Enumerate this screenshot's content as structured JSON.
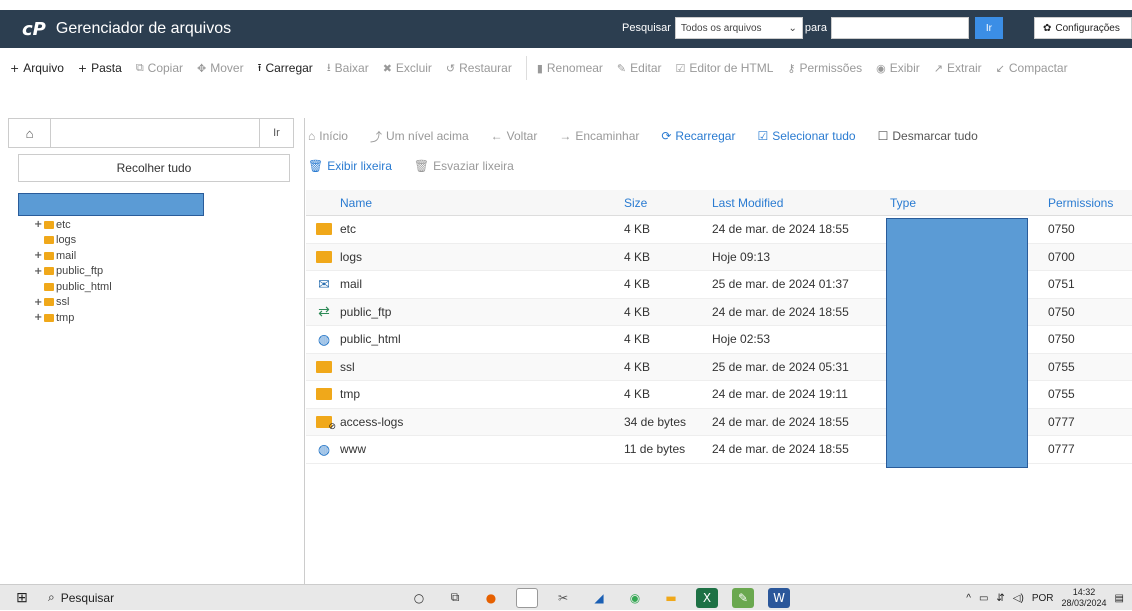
{
  "header": {
    "logo": "cP",
    "title": "Gerenciador de arquivos",
    "search_label": "Pesquisar",
    "search_scope": "Todos os arquivos",
    "for_label": "para",
    "go_label": "Ir",
    "settings_label": "Configurações"
  },
  "toolbar": [
    {
      "label": "Arquivo",
      "icon": "+",
      "active": true
    },
    {
      "label": "Pasta",
      "icon": "+",
      "active": true
    },
    {
      "label": "Copiar",
      "icon": "⧉",
      "active": false
    },
    {
      "label": "Mover",
      "icon": "✥",
      "active": false
    },
    {
      "label": "Carregar",
      "icon": "⭱",
      "active": true
    },
    {
      "label": "Baixar",
      "icon": "⭳",
      "active": false
    },
    {
      "label": "Excluir",
      "icon": "✖",
      "active": false
    },
    {
      "label": "Restaurar",
      "icon": "↺",
      "active": false
    },
    {
      "label": "Renomear",
      "icon": "▮",
      "active": false
    },
    {
      "label": "Editar",
      "icon": "✎",
      "active": false
    },
    {
      "label": "Editor de HTML",
      "icon": "☑",
      "active": false
    },
    {
      "label": "Permissões",
      "icon": "⚷",
      "active": false
    },
    {
      "label": "Exibir",
      "icon": "◉",
      "active": false
    },
    {
      "label": "Extrair",
      "icon": "↗",
      "active": false
    },
    {
      "label": "Compactar",
      "icon": "↙",
      "active": false
    }
  ],
  "left": {
    "go_label": "Ir",
    "collapse_label": "Recolher tudo",
    "tree": [
      {
        "label": "etc",
        "expandable": true
      },
      {
        "label": "logs",
        "expandable": false
      },
      {
        "label": "mail",
        "expandable": true
      },
      {
        "label": "public_ftp",
        "expandable": true
      },
      {
        "label": "public_html",
        "expandable": false
      },
      {
        "label": "ssl",
        "expandable": true
      },
      {
        "label": "tmp",
        "expandable": true
      }
    ]
  },
  "nav": {
    "home": "Início",
    "up": "Um nível acima",
    "back": "Voltar",
    "forward": "Encaminhar",
    "reload": "Recarregar",
    "select_all": "Selecionar tudo",
    "deselect_all": "Desmarcar tudo",
    "show_trash": "Exibir lixeira",
    "empty_trash": "Esvaziar lixeira"
  },
  "table": {
    "columns": [
      "Name",
      "Size",
      "Last Modified",
      "Type",
      "Permissions"
    ],
    "rows": [
      {
        "icon": "folder",
        "name": "etc",
        "size": "4 KB",
        "modified": "24 de mar. de 2024 18:55",
        "perm": "0750"
      },
      {
        "icon": "folder",
        "name": "logs",
        "size": "4 KB",
        "modified": "Hoje 09:13",
        "perm": "0700"
      },
      {
        "icon": "mail",
        "name": "mail",
        "size": "4 KB",
        "modified": "25 de mar. de 2024 01:37",
        "perm": "0751"
      },
      {
        "icon": "transfer",
        "name": "public_ftp",
        "size": "4 KB",
        "modified": "24 de mar. de 2024 18:55",
        "perm": "0750"
      },
      {
        "icon": "globe",
        "name": "public_html",
        "size": "4 KB",
        "modified": "Hoje 02:53",
        "perm": "0750"
      },
      {
        "icon": "folder",
        "name": "ssl",
        "size": "4 KB",
        "modified": "25 de mar. de 2024 05:31",
        "perm": "0755"
      },
      {
        "icon": "folder",
        "name": "tmp",
        "size": "4 KB",
        "modified": "24 de mar. de 2024 19:11",
        "perm": "0755"
      },
      {
        "icon": "folder-link",
        "name": "access-logs",
        "size": "34 de bytes",
        "modified": "24 de mar. de 2024 18:55",
        "perm": "0777"
      },
      {
        "icon": "globe-link",
        "name": "www",
        "size": "11 de bytes",
        "modified": "24 de mar. de 2024 18:55",
        "perm": "0777"
      }
    ]
  },
  "taskbar": {
    "search_label": "Pesquisar",
    "lang": "POR",
    "time": "14:32",
    "date": "28/03/2024"
  },
  "colors": {
    "header_bg": "#2c3e50",
    "accent_blue": "#2a7bd1",
    "folder": "#f0a81a",
    "redaction": "#5b9bd5"
  }
}
